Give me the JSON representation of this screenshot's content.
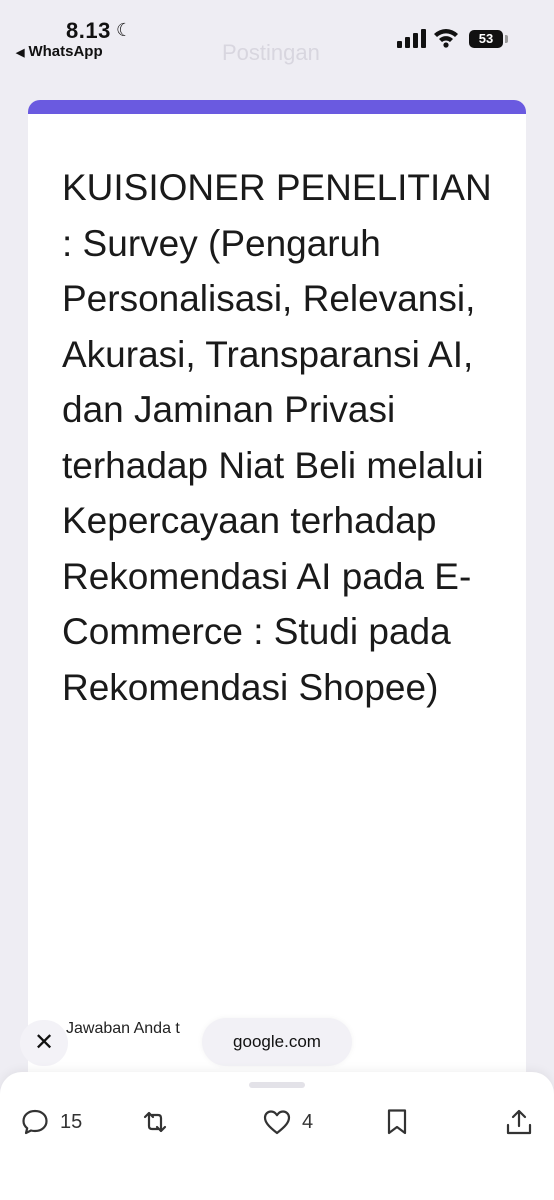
{
  "status_bar": {
    "time": "8.13",
    "back_app": "WhatsApp",
    "battery": "53"
  },
  "header": {
    "title": "Postingan"
  },
  "card": {
    "title": "KUISIONER PENELITIAN : Survey (Pengaruh Personalisasi, Relevansi, Akurasi, Transparansi AI, dan Jaminan Privasi terhadap Niat Beli melalui Kepercayaan terhadap Rekomendasi AI pada E-Commerce : Studi pada Rekomendasi Shopee)",
    "note": "Jawaban Anda t"
  },
  "toast": {
    "text": "google.com"
  },
  "actions": {
    "replies": "15",
    "likes": "4"
  },
  "colors": {
    "accent": "#6a5ae0",
    "background": "#eeedf3"
  }
}
